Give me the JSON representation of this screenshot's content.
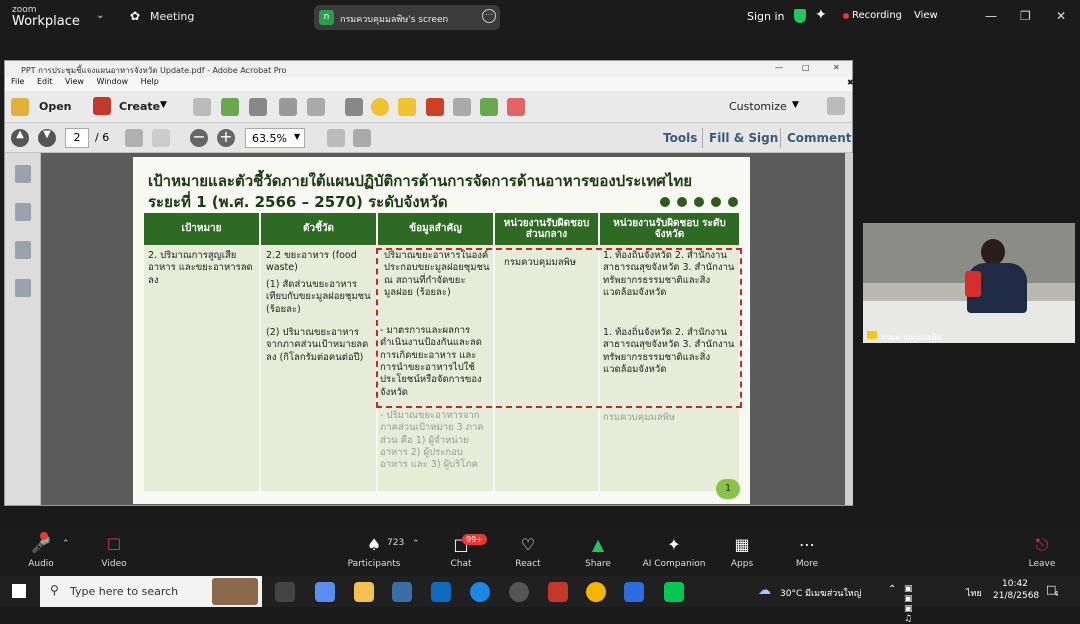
{
  "zoom_top": {
    "logo_line1": "zoom",
    "logo_line2": "Workplace",
    "meeting_label": "Meeting",
    "share_badge": "n",
    "share_title": "กรมควบคุมมลพิษ's screen",
    "sign_in": "Sign in",
    "recording": "Recording",
    "view": "View"
  },
  "acrobat": {
    "window_title": "PPT การประชุมชี้แจงแผนอาหารจังหวัด Update.pdf - Adobe Acrobat Pro",
    "menu": [
      "File",
      "Edit",
      "View",
      "Window",
      "Help"
    ],
    "open": "Open",
    "create": "Create",
    "customize": "Customize",
    "page_current": "2",
    "page_total": "/ 6",
    "zoom": "63.5%",
    "tools": "Tools",
    "fill_sign": "Fill & Sign",
    "comment": "Comment"
  },
  "slide": {
    "title1": "เป้าหมายและตัวชี้วัดภายใต้แผนปฏิบัติการด้านการจัดการด้านอาหารของประเทศไทย",
    "title2": "ระยะที่ 1 (พ.ศ. 2566 – 2570) ระดับจังหวัด",
    "headers": [
      "เป้าหมาย",
      "ตัวชี้วัด",
      "ข้อมูลสำคัญ",
      "หน่วยงานรับผิดชอบ ส่วนกลาง",
      "หน่วยงานรับผิดชอบ ระดับจังหวัด"
    ],
    "goal": "2. ปริมาณการสูญเสียอาหาร และขยะอาหารลดลง",
    "ind_a": "2.2 ขยะอาหาร (food waste)",
    "ind_b": "(1) สัดส่วนขยะอาหารเทียบกับขยะมูลฝอยชุมชน (ร้อยละ)",
    "ind_c": "(2) ปริมาณขยะอาหารจากภาคส่วนเป้าหมายลดลง (กิโลกรัมต่อคนต่อปี)",
    "data_a": "ปริมาณขยะอาหารในองค์ประกอบขยะมูลฝอยชุมชน ณ สถานที่กำจัดขยะมูลฝอย (ร้อยละ)",
    "data_b": "- มาตรการและผลการดำเนินงานป้องกันและลดการเกิดขยะอาหาร และการนำขยะอาหารไปใช้ประโยชน์หรือจัดการของจังหวัด",
    "data_c": "- ปริมาณขยะอาหารจากภาคส่วนเป้าหมาย 3 ภาคส่วน คือ 1) ผู้จำหน่ายอาหาร 2) ผู้ประกอบอาหาร และ 3) ผู้บริโภค",
    "central": "กรมควบคุมมลพิษ",
    "prov_a": "1. ท้องถิ่นจังหวัด 2. สำนักงานสาธารณสุขจังหวัด 3. สำนักงานทรัพยากรธรรมชาติและสิ่งแวดล้อมจังหวัด",
    "prov_b": "1. ท้องถิ่นจังหวัด 2. สำนักงานสาธารณสุขจังหวัด 3. สำนักงานทรัพยากรธรรมชาติและสิ่งแวดล้อมจังหวัด",
    "prov_c": "กรมควบคุมมลพิษ",
    "page_number": "1"
  },
  "video_tile": {
    "name": "กรมควบคุมมลพิษ"
  },
  "controls": {
    "audio": "Audio",
    "video": "Video",
    "participants": "Participants",
    "participants_count": "723",
    "chat": "Chat",
    "chat_badge": "99+",
    "react": "React",
    "share": "Share",
    "ai_companion": "AI Companion",
    "apps": "Apps",
    "more": "More",
    "leave": "Leave"
  },
  "taskbar": {
    "search_placeholder": "Type here to search",
    "weather": "30°C มีเมฆส่วนใหญ่",
    "lang": "ไทย",
    "time": "10:42",
    "date": "21/8/2568",
    "notif": "4"
  }
}
